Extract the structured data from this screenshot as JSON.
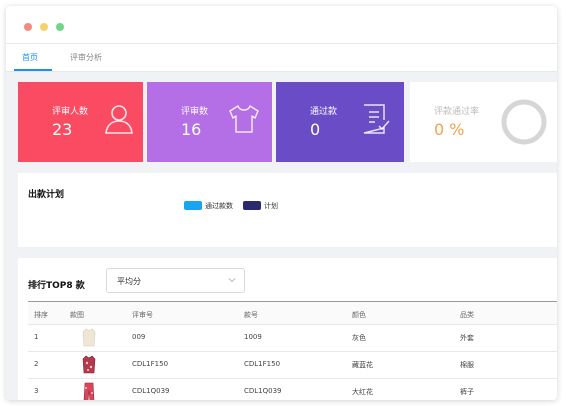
{
  "tabs": [
    {
      "label": "首页",
      "active": true
    },
    {
      "label": "评审分析",
      "active": false
    }
  ],
  "stats": [
    {
      "label": "评审人数",
      "value": "23",
      "icon": "user-icon",
      "color": "#fa4b63"
    },
    {
      "label": "评审数",
      "value": "16",
      "icon": "tshirt-icon",
      "color": "#b46fe6"
    },
    {
      "label": "通过款",
      "value": "0",
      "icon": "checklist-icon",
      "color": "#6a4dc6"
    },
    {
      "label": "评款通过率",
      "value": "0 %",
      "icon": "ring-icon",
      "color": "#ffffff"
    }
  ],
  "plan": {
    "title": "出款计划",
    "legend": [
      {
        "label": "通过款数",
        "color": "#1aa3f0"
      },
      {
        "label": "计划",
        "color": "#2a2a6e"
      }
    ]
  },
  "top8": {
    "title": "排行TOP8 款",
    "select_value": "平均分",
    "columns": [
      "排序",
      "款图",
      "评审号",
      "款号",
      "颜色",
      "品类"
    ],
    "rows": [
      {
        "rank": "1",
        "review_no": "009",
        "style_no": "1009",
        "color": "灰色",
        "category": "外套"
      },
      {
        "rank": "2",
        "review_no": "CDL1F150",
        "style_no": "CDL1F150",
        "color": "藏蓝花",
        "category": "棉服"
      },
      {
        "rank": "3",
        "review_no": "CDL1Q039",
        "style_no": "CDL1Q039",
        "color": "大红花",
        "category": "裤子"
      }
    ]
  }
}
